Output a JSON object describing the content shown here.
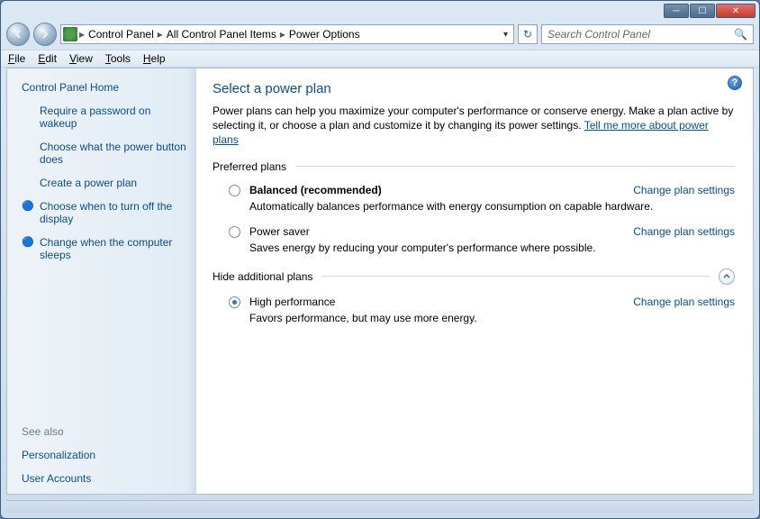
{
  "breadcrumb": {
    "a": "Control Panel",
    "b": "All Control Panel Items",
    "c": "Power Options"
  },
  "search": {
    "placeholder": "Search Control Panel"
  },
  "menu": {
    "file": "File",
    "edit": "Edit",
    "view": "View",
    "tools": "Tools",
    "help": "Help"
  },
  "sidebar": {
    "home": "Control Panel Home",
    "items": [
      "Require a password on wakeup",
      "Choose what the power button does",
      "Create a power plan",
      "Choose when to turn off the display",
      "Change when the computer sleeps"
    ],
    "see_also_label": "See also",
    "see_also": [
      "Personalization",
      "User Accounts"
    ]
  },
  "page": {
    "title": "Select a power plan",
    "intro": "Power plans can help you maximize your computer's performance or conserve energy. Make a plan active by selecting it, or choose a plan and customize it by changing its power settings. ",
    "intro_link": "Tell me more about power plans",
    "section_preferred": "Preferred plans",
    "section_additional": "Hide additional plans",
    "change_link": "Change plan settings"
  },
  "plans": {
    "balanced": {
      "name": "Balanced (recommended)",
      "desc": "Automatically balances performance with energy consumption on capable hardware."
    },
    "saver": {
      "name": "Power saver",
      "desc": "Saves energy by reducing your computer's performance where possible."
    },
    "highperf": {
      "name": "High performance",
      "desc": "Favors performance, but may use more energy."
    }
  }
}
